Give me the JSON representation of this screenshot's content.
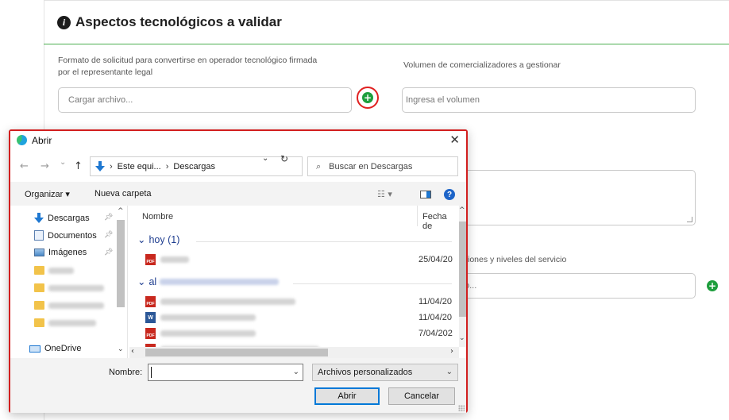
{
  "form": {
    "section_title": "Aspectos tecnológicos a validar",
    "field1_label": "Formato de solicitud para convertirse en operador tecnológico firmada por el representante legal",
    "field1_placeholder": "Cargar archivo...",
    "field2_label": "Volumen de comercializadores a gestionar",
    "field2_placeholder": "Ingresa el volumen",
    "field3_label_partial": "iones y niveles del servicio",
    "field3_placeholder_partial": "o..."
  },
  "dialog": {
    "title": "Abrir",
    "close_symbol": "✕",
    "nav": {
      "back": "←",
      "forward": "→",
      "recent": "⌄",
      "up": "↑"
    },
    "breadcrumb": [
      "Este equi...",
      "Descargas"
    ],
    "search_placeholder": "Buscar en Descargas",
    "toolbar": {
      "organize": "Organizar ▾",
      "new_folder": "Nueva carpeta",
      "view_symbol": "☷ ▾",
      "help_symbol": "?"
    },
    "sidebar": [
      {
        "label": "Descargas",
        "icon": "download-arrow-icon",
        "pinned": true
      },
      {
        "label": "Documentos",
        "icon": "documents-icon",
        "pinned": true
      },
      {
        "label": "Imágenes",
        "icon": "pictures-icon",
        "pinned": true
      },
      {
        "label": "",
        "icon": "folder-icon",
        "pinned": false
      },
      {
        "label": "",
        "icon": "folder-icon",
        "pinned": false
      },
      {
        "label": "",
        "icon": "folder-icon",
        "pinned": false
      },
      {
        "label": "",
        "icon": "folder-icon",
        "pinned": false
      },
      {
        "label": "OneDrive",
        "icon": "onedrive-icon",
        "pinned": false
      }
    ],
    "columns": {
      "name": "Nombre",
      "date": "Fecha de"
    },
    "groups": [
      {
        "label": "hoy (1)",
        "files": [
          {
            "type": "pdf",
            "date": "25/04/20"
          }
        ]
      },
      {
        "label": "al",
        "files": [
          {
            "type": "pdf",
            "date": "11/04/20"
          },
          {
            "type": "word",
            "date": "11/04/20"
          },
          {
            "type": "pdf",
            "date": "7/04/202"
          },
          {
            "type": "pdf",
            "date": ""
          }
        ]
      }
    ],
    "filename_label": "Nombre:",
    "filename_value": "",
    "filetype_value": "Archivos personalizados",
    "open_button": "Abrir",
    "cancel_button": "Cancelar"
  },
  "colors": {
    "accent_green": "#1e9e3d",
    "highlight_red": "#d21f1f",
    "link_blue": "#1e3d8f"
  }
}
